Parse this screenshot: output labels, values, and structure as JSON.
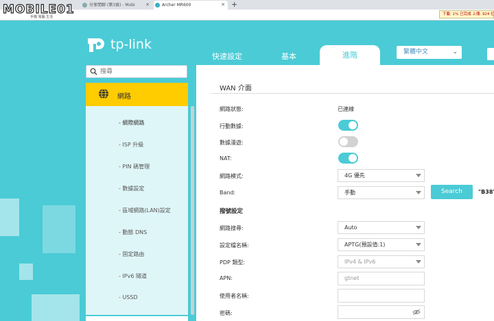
{
  "browser": {
    "tabs": [
      {
        "label": "分享閒聊 (第3頁) - Mobi"
      },
      {
        "label": "Archer MR600"
      }
    ],
    "speed_text": "下載: 1% 已完成 上傳: 924 位元",
    "watermark": {
      "brand": "MOBILE01",
      "sub": "手機 電腦 生活"
    }
  },
  "header": {
    "brand": "tp-link",
    "nav": {
      "quick": "快速設定",
      "basic": "基本",
      "advanced": "進階"
    },
    "language": "繁體中文"
  },
  "sidebar": {
    "search_placeholder": "搜尋",
    "active": "網路",
    "items": [
      {
        "label": "- 網際網路"
      },
      {
        "label": "- ISP 升級"
      },
      {
        "label": "- PIN 碼管理"
      },
      {
        "label": "- 數據設定"
      },
      {
        "label": "- 區域網路(LAN)設定"
      },
      {
        "label": "- 動態 DNS"
      },
      {
        "label": "- 固定路由"
      },
      {
        "label": "- IPv6 隧道"
      },
      {
        "label": "- USSD"
      }
    ]
  },
  "main": {
    "title": "WAN 介面",
    "status_label": "網路狀態:",
    "status_value": "已連線",
    "mobile_data_label": "行動數據:",
    "roaming_label": "數據漫遊:",
    "nat_label": "NAT:",
    "network_mode_label": "網路模式:",
    "network_mode_value": "4G 優先",
    "band_label": "Band:",
    "band_value": "手動",
    "search_button": "Search",
    "band_note": "\"B38\"",
    "dial_header": "撥號設定",
    "network_search_label": "網路搜尋:",
    "network_search_value": "Auto",
    "profile_label": "設定檔名稱:",
    "profile_value": "APTG(預設值:1)",
    "pdp_label": "PDP 類型:",
    "pdp_value": "IPv4 & IPv6",
    "apn_label": "APN:",
    "apn_value": "gtnet",
    "username_label": "使用者名稱:",
    "password_label": "密碼:"
  }
}
